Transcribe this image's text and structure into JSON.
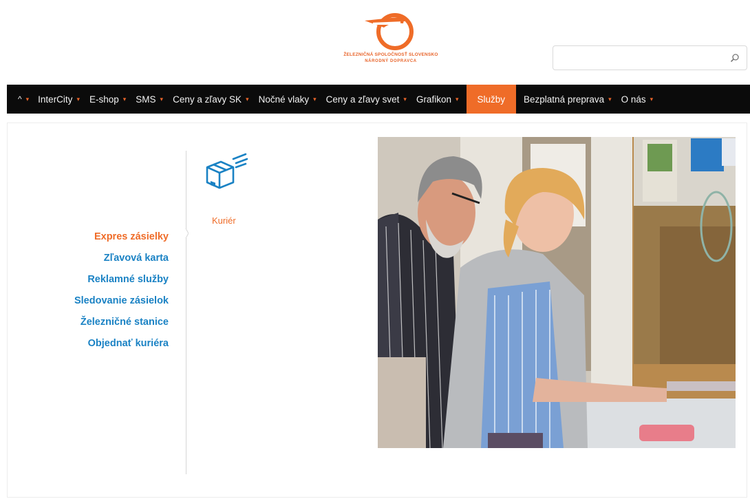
{
  "header": {
    "logo_line1": "ŽELEZNIČNÁ SPOLOČNOSŤ SLOVENSKO",
    "logo_line2": "NÁRODNÝ DOPRAVCA",
    "search_placeholder": "",
    "search_value": ""
  },
  "nav": {
    "home_label": "^",
    "items": [
      {
        "label": "InterCity"
      },
      {
        "label": "E-shop"
      },
      {
        "label": "SMS"
      },
      {
        "label": "Ceny a zľavy SK"
      },
      {
        "label": "Nočné vlaky"
      },
      {
        "label": "Ceny a zľavy svet"
      },
      {
        "label": "Grafikon"
      },
      {
        "label": "Služby"
      },
      {
        "label": "Bezplatná preprava"
      },
      {
        "label": "O nás"
      }
    ],
    "active_label": "Služby"
  },
  "side_menu": {
    "items": [
      {
        "label": "Expres zásielky"
      },
      {
        "label": "Zľavová karta"
      },
      {
        "label": "Reklamné služby"
      },
      {
        "label": "Sledovanie zásielok"
      },
      {
        "label": "Železničné stanice"
      },
      {
        "label": "Objednať kuriéra"
      }
    ],
    "active_label": "Expres zásielky"
  },
  "service": {
    "icon": "courier-box-icon",
    "label": "Kuriér"
  },
  "photo": {
    "subject": "people-at-ticket-counter-photo"
  },
  "colors": {
    "accent": "#ef6c28",
    "nav_bg": "#0b0b0b",
    "link_blue": "#1a82c4"
  }
}
